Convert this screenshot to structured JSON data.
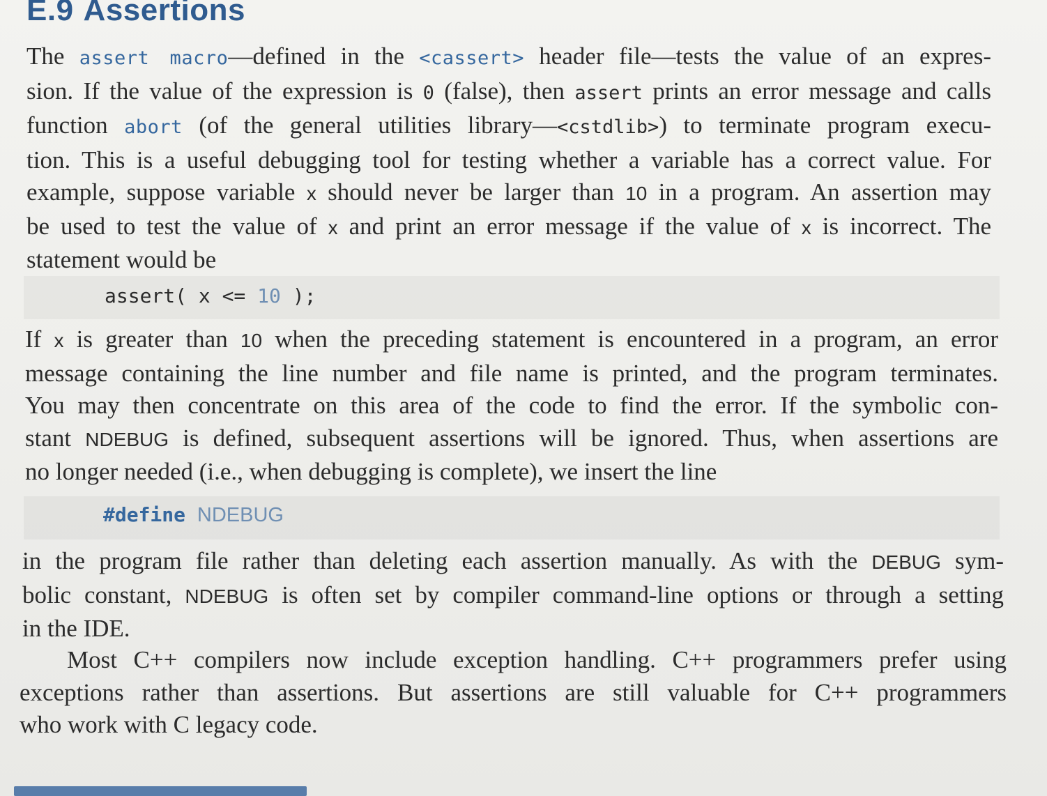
{
  "section": {
    "number": "E.9",
    "title": "Assertions"
  },
  "p1": {
    "l1": [
      "The ",
      "assert macro",
      "—defined in the ",
      "<cassert>",
      " header file—tests the value of an expres-"
    ],
    "l2": [
      "sion. If the value of the expression is ",
      "0",
      " (false), then ",
      "assert",
      " prints an error message and calls"
    ],
    "l3": [
      "function ",
      "abort",
      " (of the general utilities library—",
      "<cstdlib>",
      ") to terminate program execu-"
    ],
    "l4": "tion. This is a useful debugging tool for testing whether a variable has a correct value. For",
    "l5": [
      "example, suppose variable ",
      "x",
      " should never be larger than ",
      "10",
      " in a program. An assertion may"
    ],
    "l6": [
      "be used to test the value of ",
      "x",
      " and print an error message if the value of ",
      "x",
      " is incorrect. The"
    ],
    "l7": "statement would be"
  },
  "code1": {
    "pre": "assert( x <= ",
    "literal": "10",
    "post": " );"
  },
  "p2": {
    "l1": [
      "If ",
      "x",
      " is greater than ",
      "10",
      " when the preceding statement is encountered in a program, an error"
    ],
    "l2": "message containing the line number and file name is printed, and the program terminates.",
    "l3": "You may then concentrate on this area of the code to find the error. If the symbolic con-",
    "l4": [
      "stant ",
      "NDEBUG",
      " is defined, subsequent assertions will be ignored. Thus, when assertions are"
    ],
    "l5": "no longer needed (i.e., when debugging is complete), we insert the line"
  },
  "code2": {
    "directive": "#define",
    "identifier": "NDEBUG"
  },
  "p3": {
    "l1": [
      "in the program file rather than deleting each assertion manually. As with the ",
      "DEBUG",
      " sym-"
    ],
    "l2": [
      "bolic constant, ",
      "NDEBUG",
      " is often set by compiler command-line options or through a setting"
    ],
    "l3": "in the IDE."
  },
  "p4": {
    "l1": "Most C++ compilers now include exception handling. C++ programmers prefer using",
    "l2": "exceptions rather than assertions. But assertions are still valuable for C++ programmers",
    "l3": "who work with C legacy code."
  }
}
